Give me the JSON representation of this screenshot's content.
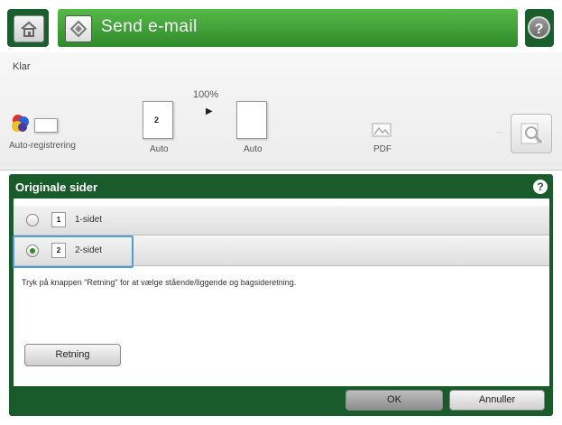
{
  "header": {
    "title": "Send e-mail",
    "home_icon": "home-icon",
    "app_icon": "send-email-icon",
    "help_label": "?"
  },
  "status": {
    "text": "Klar"
  },
  "settings": {
    "color_label": "Auto-registrering",
    "zoom": "100%",
    "sides_label": "Auto",
    "sides_value": "2",
    "size_label": "Auto",
    "format_label": "PDF"
  },
  "panel": {
    "title": "Originale sider",
    "help_label": "?",
    "options": [
      {
        "number": "1",
        "label": "1-sidet",
        "selected": false
      },
      {
        "number": "2",
        "label": "2-sidet",
        "selected": true
      }
    ],
    "description": "Tryk på knappen \"Retning\" for at vælge stående/liggende og bagsideretning.",
    "orientation_button": "Retning",
    "ok_button": "OK",
    "cancel_button": "Annuller"
  },
  "colors": {
    "title_bar": "#3c9a34",
    "panel": "#1a5b2c",
    "selection": "#4a9fd6"
  }
}
